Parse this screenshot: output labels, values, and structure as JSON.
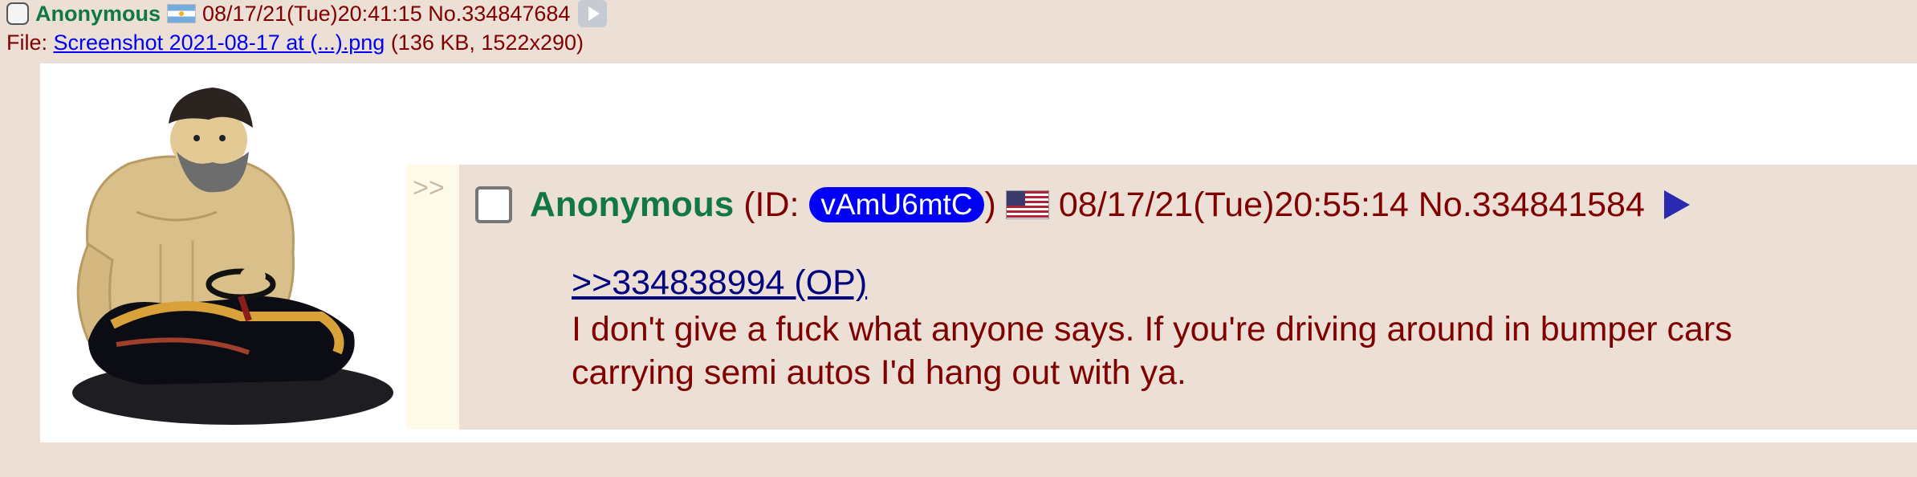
{
  "op": {
    "name": "Anonymous",
    "datetime": "08/17/21(Tue)20:41:15",
    "post_no": "No.334847684",
    "flag_icon": "argentina-flag-icon",
    "file_prefix": "File:",
    "file_link": "Screenshot 2021-08-17 at (...).png",
    "file_info": "(136 KB, 1522x290)"
  },
  "reply": {
    "side_arrows": ">>",
    "name": "Anonymous",
    "id_open": "(ID:",
    "id_value": "vAmU6mtC",
    "id_close": ")",
    "flag_icon": "usa-flag-icon",
    "datetime": "08/17/21(Tue)20:55:14",
    "post_no": "No.334841584",
    "quote_link": ">>334838994 (OP)",
    "message_line1": "I don't give a fuck what anyone says. If you're driving around in bumper cars",
    "message_line2": "carrying semi autos I'd hang out with ya."
  },
  "colors": {
    "background": "#ece0d6",
    "name_green": "#117743",
    "text_maroon": "#800000",
    "id_pill": "#0000f4",
    "link_blue": "#0000ee"
  }
}
